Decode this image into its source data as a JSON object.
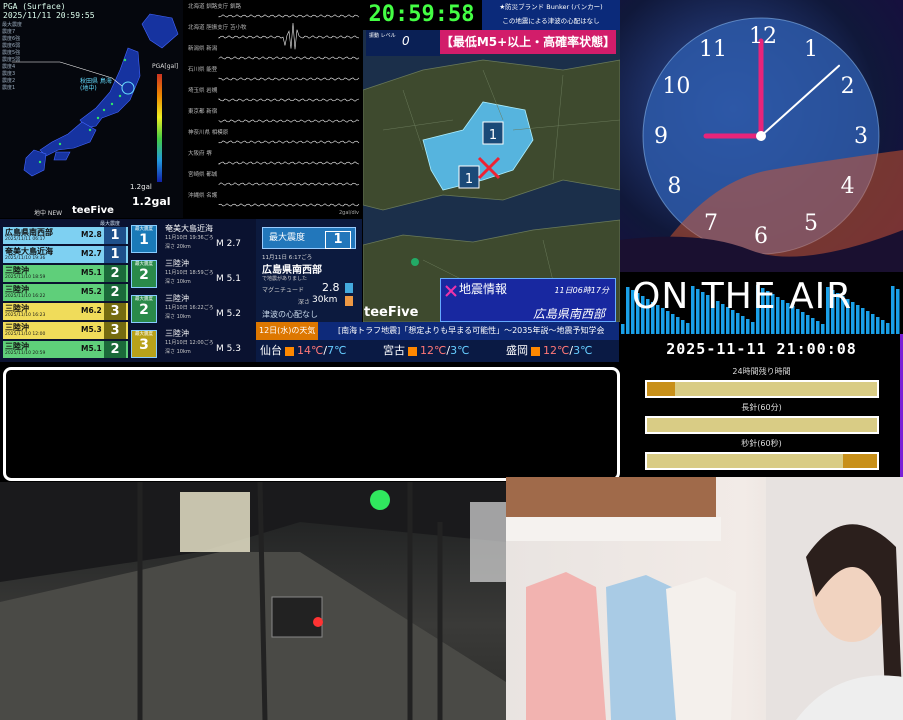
{
  "pga": {
    "title": "PGA (Surface)",
    "timestamp": "2025/11/11 20:59:55",
    "colorbar_title": "PGA[gal]",
    "gal_small": "1.2gal",
    "gal_big": "1.2gal",
    "region_label": "秋田県 鳥海 (地中)",
    "footer": "地中 NEW",
    "logo": "teeFive"
  },
  "waveforms": {
    "stations": [
      "北海道 釧路支庁 釧路",
      "北海道 胆振支庁 苫小牧",
      "新潟県 新潟",
      "石川県 能登",
      "埼玉県 岩槻",
      "東京都 新宿",
      "神奈川県 相模原",
      "大阪府 堺",
      "宮崎県 都城",
      "沖縄県 名護"
    ],
    "unit": "2gal/div"
  },
  "eq_list": {
    "header": "最大震度",
    "rows": [
      {
        "name": "広島県南西部",
        "date": "2025/11/11 06:17",
        "mag": "M2.8",
        "int": "1"
      },
      {
        "name": "奄美大島近海",
        "date": "2025/11/10 19:36",
        "mag": "M2.7",
        "int": "1"
      },
      {
        "name": "三陸沖",
        "date": "2025/11/10 18:59",
        "mag": "M5.1",
        "int": "2"
      },
      {
        "name": "三陸沖",
        "date": "2025/11/10 16:22",
        "mag": "M5.2",
        "int": "2"
      },
      {
        "name": "三陸沖",
        "date": "2025/11/10 16:23",
        "mag": "M6.2",
        "int": "3"
      },
      {
        "name": "三陸沖",
        "date": "2025/11/10 12:00",
        "mag": "M5.3",
        "int": "3"
      },
      {
        "name": "三陸沖",
        "date": "2025/11/10 20:59",
        "mag": "M5.1",
        "int": "2"
      }
    ]
  },
  "eq_detail": {
    "items": [
      {
        "badge_label": "最大震度",
        "int": "1",
        "name": "奄美大島近海",
        "time": "11月10日 19:36ごろ",
        "depth": "深さ 20km",
        "mag": "M 2.7"
      },
      {
        "badge_label": "最大震度",
        "int": "2",
        "name": "三陸沖",
        "time": "11月10日 18:59ごろ",
        "depth": "深さ 10km",
        "mag": "M 5.1"
      },
      {
        "badge_label": "最大震度",
        "int": "2",
        "name": "三陸沖",
        "time": "11月10日 16:22ごろ",
        "depth": "深さ 10km",
        "mag": "M 5.2"
      },
      {
        "badge_label": "最大震度",
        "int": "3",
        "name": "三陸沖",
        "time": "11月10日 12:00ごろ",
        "depth": "深さ 10km",
        "mag": "M 5.3"
      }
    ]
  },
  "latest": {
    "maxint_label": "最大震度",
    "maxint": "1",
    "time": "11月11日 6:17ごろ",
    "place": "広島県南西部",
    "note": "で地震がありました",
    "mag_label": "マグニチュード",
    "mag": "2.8",
    "depth_label": "深さ",
    "depth": "30km",
    "tsunami": "津波の心配なし"
  },
  "weather": {
    "date": "12日(水)の天気",
    "headline": "[南海トラフ地震]「想定よりも早まる可能性」～2035年説～地震予知学会",
    "cities": [
      {
        "name": "仙台",
        "hi": "14℃",
        "lo": "7℃"
      },
      {
        "name": "宮古",
        "hi": "12℃",
        "lo": "3℃"
      },
      {
        "name": "盛岡",
        "hi": "12℃",
        "lo": "3℃"
      }
    ]
  },
  "quake_map": {
    "time": "20:59:58",
    "brand_line1": "★防災ブランド Bunker (バンカー)",
    "brand_line2": "この地震による津波の心配はなし",
    "level_label": "振動 レベル",
    "level": "0",
    "alert": "【最低M5+以上・高確率状態】",
    "info_title": "地震情報",
    "info_time": "11日06時17分",
    "info_place": "広島県南西部",
    "marker1": "1",
    "marker2": "1",
    "logo": "teeFive"
  },
  "clock": {
    "numerals": [
      "12",
      "1",
      "2",
      "3",
      "4",
      "5",
      "6",
      "7",
      "8",
      "9",
      "10",
      "11"
    ],
    "hour_value": 9,
    "minute_value": 0,
    "second_value": 8
  },
  "onair": {
    "text": "ON THE AIR",
    "datetime": "2025-11-11 21:00:08",
    "bars": [
      {
        "label": "24時間残り時間",
        "fill": 0.12
      },
      {
        "label": "長針(60分)",
        "fill": 0.0
      },
      {
        "label": "秒針(60秒)",
        "fill": 0.85
      }
    ]
  },
  "colors": {
    "accent": "#7a1fd6",
    "alert": "#d21d6a",
    "clock_green": "#4f4"
  }
}
